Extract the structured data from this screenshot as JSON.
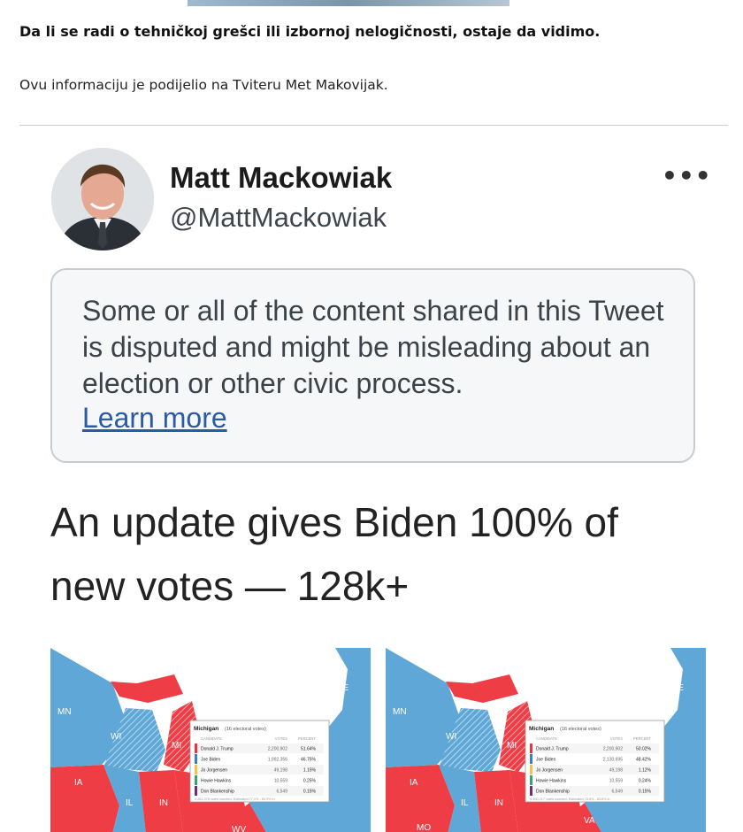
{
  "article": {
    "lead_bold": "Da li se radi o tehničkoj grešci ili izbornoj nelogičnosti, ostaje da vidimo.",
    "lead_text": "Ovu informaciju je podijelio na Tviteru Met Makovijak."
  },
  "tweet": {
    "author_name": "Matt Mackowiak",
    "author_handle": "@MattMackowiak",
    "more_icon": "•••",
    "notice_text": "Some or all of the content shared in this Tweet is disputed and might be misleading about an election or other civic process.",
    "notice_link": "Learn more",
    "text_line1": "An update gives Biden 100% of",
    "text_line2": "new votes — 128k+"
  },
  "maps": [
    {
      "state_labels": [
        "MN",
        "WI",
        "MI",
        "IA",
        "IL",
        "IN",
        "ME",
        "WV"
      ],
      "popup": {
        "title": "Michigan",
        "subtitle": "(16 electoral votes)",
        "headers": [
          "CANDIDATE",
          "VOTES",
          "PERCENT"
        ],
        "rows": [
          {
            "name": "Donald J. Trump",
            "votes": "2,200,902",
            "percent": "51.64%",
            "color": "#e8343e"
          },
          {
            "name": "Joe Biden",
            "votes": "1,992,356",
            "percent": "46.75%",
            "color": "#3a7ec6"
          },
          {
            "name": "Jo Jorgensen",
            "votes": "49,198",
            "percent": "1.15%",
            "color": "#f2c14e"
          },
          {
            "name": "Howie Hawkins",
            "votes": "10,559",
            "percent": "0.25%",
            "color": "#3aa36b"
          },
          {
            "name": "Don Blankenship",
            "votes": "6,549",
            "percent": "0.15%",
            "color": "#6b2f7a"
          }
        ],
        "footer": "4,261,378 votes counted. Estimated 77.1% - 80.9% in"
      }
    },
    {
      "state_labels": [
        "MN",
        "WI",
        "MI",
        "IA",
        "IL",
        "IN",
        "ME",
        "MO",
        "VA"
      ],
      "popup": {
        "title": "Michigan",
        "subtitle": "(16 electoral votes)",
        "headers": [
          "CANDIDATE",
          "VOTES",
          "PERCENT"
        ],
        "rows": [
          {
            "name": "Donald J. Trump",
            "votes": "2,200,902",
            "percent": "50.02%",
            "color": "#e8343e"
          },
          {
            "name": "Joe Biden",
            "votes": "2,130,695",
            "percent": "48.42%",
            "color": "#3a7ec6"
          },
          {
            "name": "Jo Jorgensen",
            "votes": "49,198",
            "percent": "1.12%",
            "color": "#f2c14e"
          },
          {
            "name": "Howie Hawkins",
            "votes": "10,559",
            "percent": "0.24%",
            "color": "#3aa36b"
          },
          {
            "name": "Don Blankenship",
            "votes": "6,549",
            "percent": "0.15%",
            "color": "#6b2f7a"
          }
        ],
        "footer": "4,400,217 votes counted. Estimated 78.6% - 83.8% in"
      }
    }
  ],
  "colors": {
    "republican": "#ee3d45",
    "democrat": "#5fa7d6",
    "link": "#2b5aa6"
  }
}
